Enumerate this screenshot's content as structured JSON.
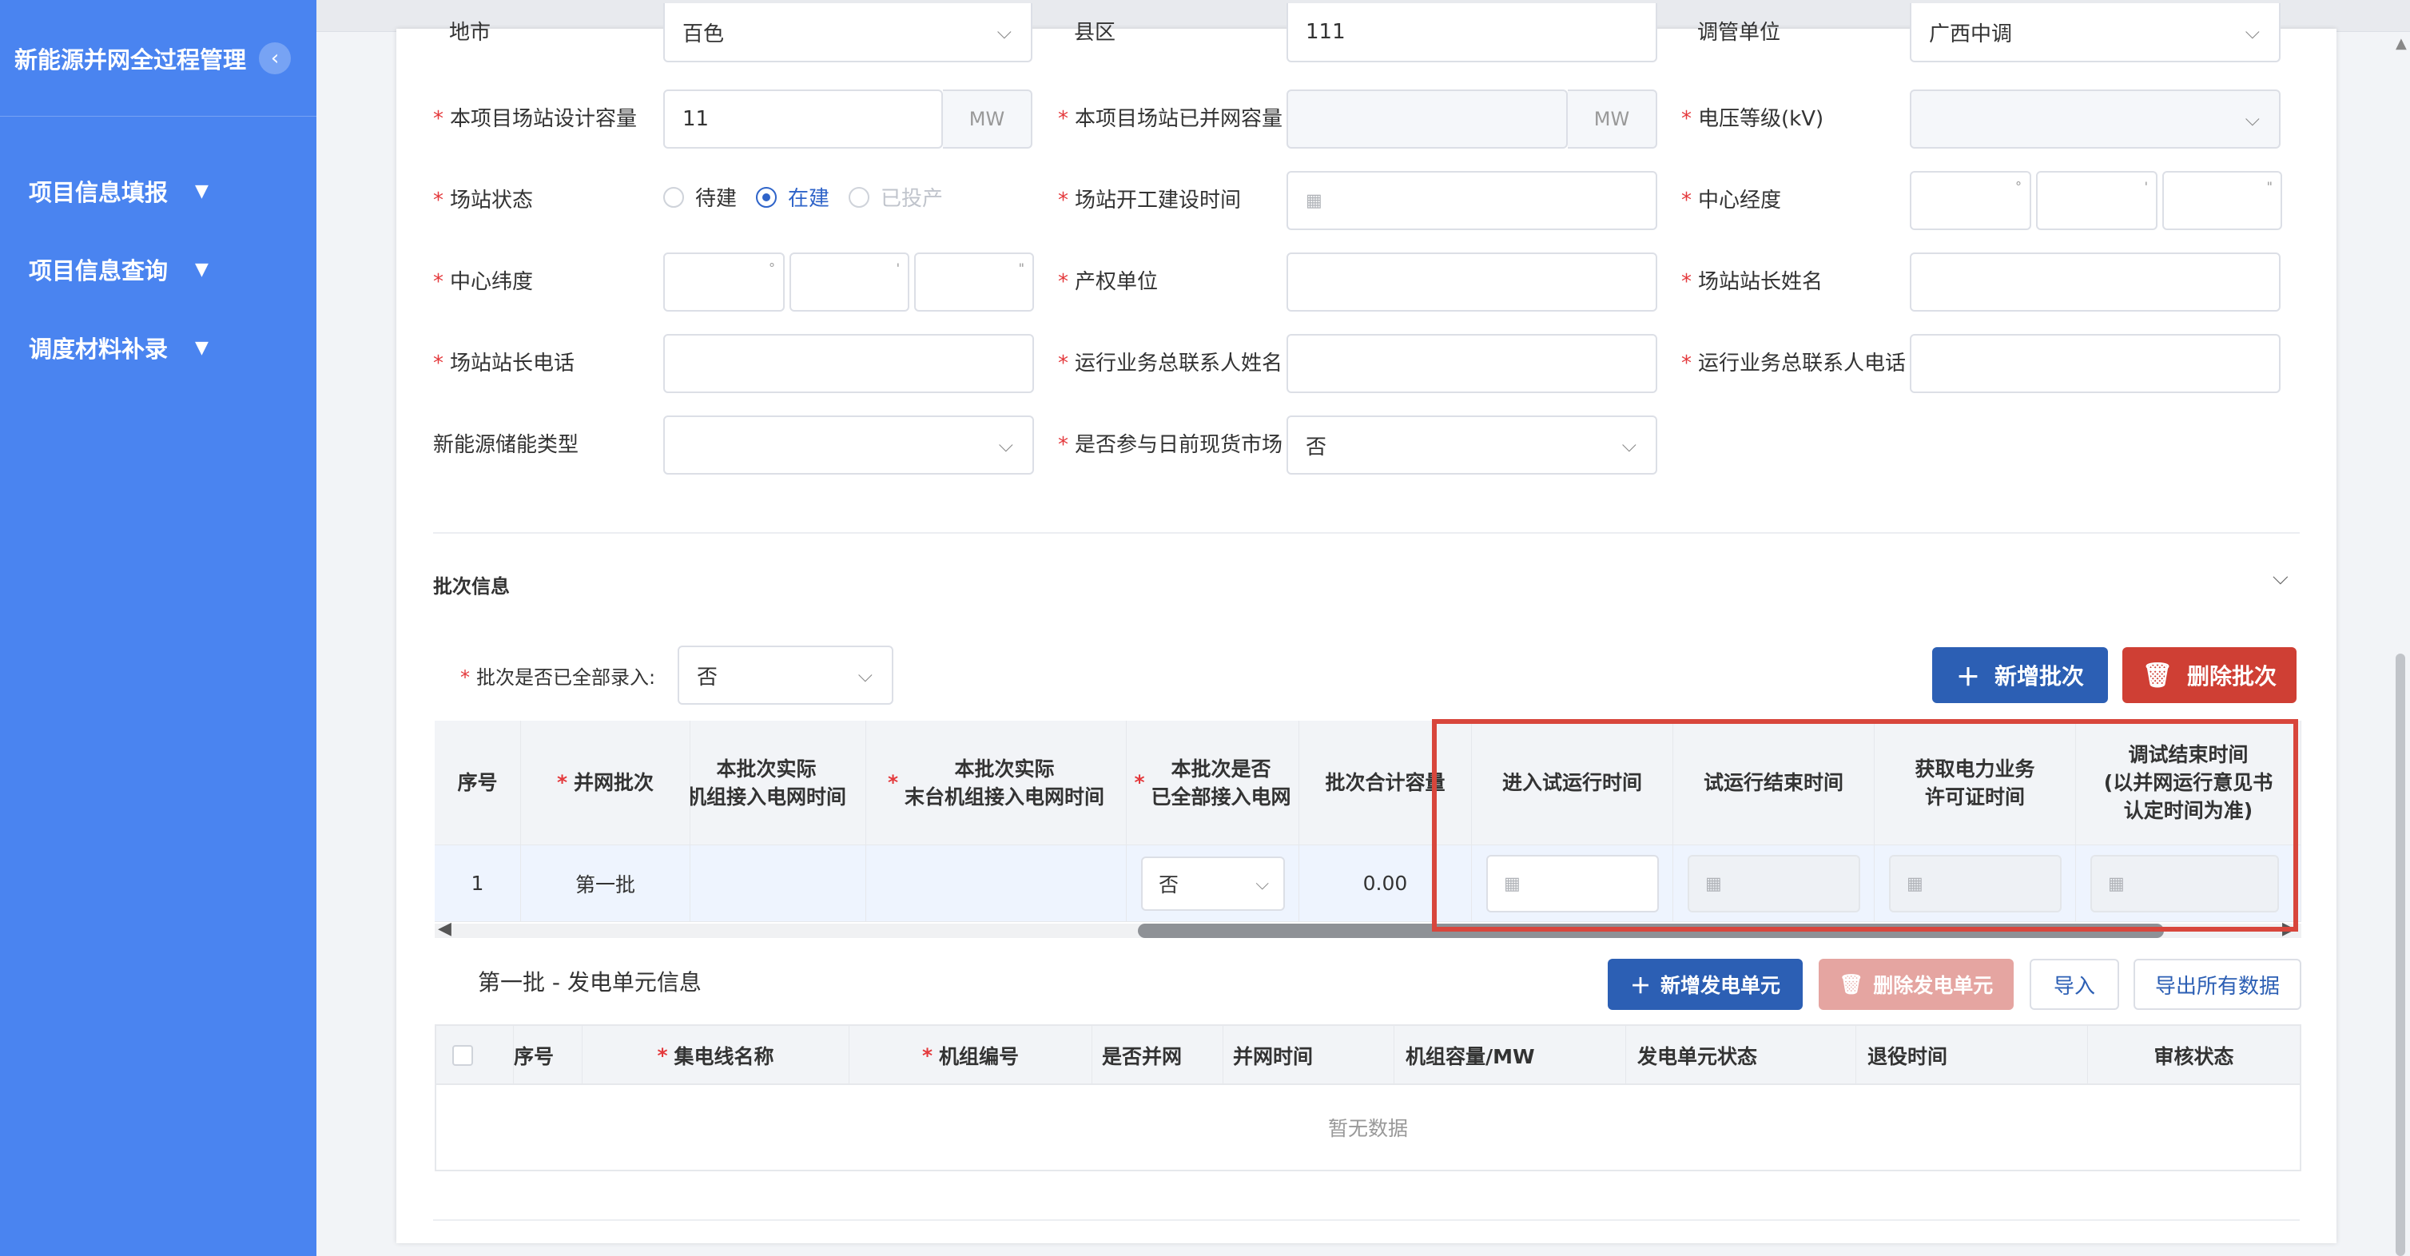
{
  "sidebar": {
    "title": "新能源并网全过程管理",
    "collapse_icon": "chevron-left-icon",
    "items": [
      {
        "label": "项目信息填报"
      },
      {
        "label": "项目信息查询"
      },
      {
        "label": "调度材料补录"
      }
    ]
  },
  "form": {
    "row0": {
      "city_label": "地市",
      "city_value": "百色",
      "county_label": "县区",
      "county_value": "111",
      "dispatch_label": "调管单位",
      "dispatch_value": "广西中调"
    },
    "design_capacity": {
      "label": "本项目场站设计容量",
      "value": "11",
      "unit": "MW"
    },
    "connected_capacity": {
      "label": "本项目场站已并网容量",
      "value": "",
      "unit": "MW"
    },
    "voltage_level": {
      "label": "电压等级(kV)",
      "value": ""
    },
    "station_status": {
      "label": "场站状态",
      "options": [
        {
          "label": "待建",
          "state": "unchecked"
        },
        {
          "label": "在建",
          "state": "checked"
        },
        {
          "label": "已投产",
          "state": "disabled"
        }
      ]
    },
    "construction_start": {
      "label": "场站开工建设时间",
      "value": ""
    },
    "center_longitude": {
      "label": "中心经度"
    },
    "center_latitude": {
      "label": "中心纬度"
    },
    "property_unit": {
      "label": "产权单位",
      "value": ""
    },
    "station_master_name": {
      "label": "场站站长姓名",
      "value": ""
    },
    "station_master_phone": {
      "label": "场站站长电话",
      "value": ""
    },
    "ops_contact_name": {
      "label": "运行业务总联系人姓名",
      "value": ""
    },
    "ops_contact_phone": {
      "label": "运行业务总联系人电话",
      "value": ""
    },
    "storage_type": {
      "label": "新能源储能类型",
      "value": ""
    },
    "spot_market": {
      "label": "是否参与日前现货市场",
      "value": "否"
    }
  },
  "batch": {
    "section_title": "批次信息",
    "all_entered_label": "批次是否已全部录入:",
    "all_entered_value": "否",
    "add_button": "新增批次",
    "delete_button": "删除批次",
    "columns": {
      "seq": "序号",
      "batch": "并网批次",
      "first_unit_line1": "本批次实际",
      "first_unit_line2": "机组接入电网时间",
      "last_unit_line1": "本批次实际",
      "last_unit_line2": "末台机组接入电网时间",
      "all_connected_line1": "本批次是否",
      "all_connected_line2": "已全部接入电网",
      "total_capacity": "批次合计容量",
      "trial_start": "进入试运行时间",
      "trial_end": "试运行结束时间",
      "license_line1": "获取电力业务",
      "license_line2": "许可证时间",
      "debug_end_line1": "调试结束时间",
      "debug_end_line2": "(以并网运行意见书",
      "debug_end_line3": "认定时间为准)"
    },
    "rows": [
      {
        "seq": "1",
        "batch": "第一批",
        "all_connected": "否",
        "total_capacity": "0.00"
      }
    ]
  },
  "units": {
    "title": "第一批 - 发电单元信息",
    "add_button": "新增发电单元",
    "delete_button": "删除发电单元",
    "import_button": "导入",
    "export_button": "导出所有数据",
    "columns": {
      "seq": "序号",
      "collector": "集电线名称",
      "unit_no": "机组编号",
      "connected": "是否并网",
      "connect_time": "并网时间",
      "capacity": "机组容量/MW",
      "status": "发电单元状态",
      "retire_time": "退役时间",
      "audit": "审核状态"
    },
    "empty_text": "暂无数据"
  },
  "colors": {
    "sidebar": "#4a84f0",
    "primary": "#2c5fb4",
    "danger": "#cf3f34",
    "highlight": "#d8463c",
    "required": "#e4393c"
  }
}
